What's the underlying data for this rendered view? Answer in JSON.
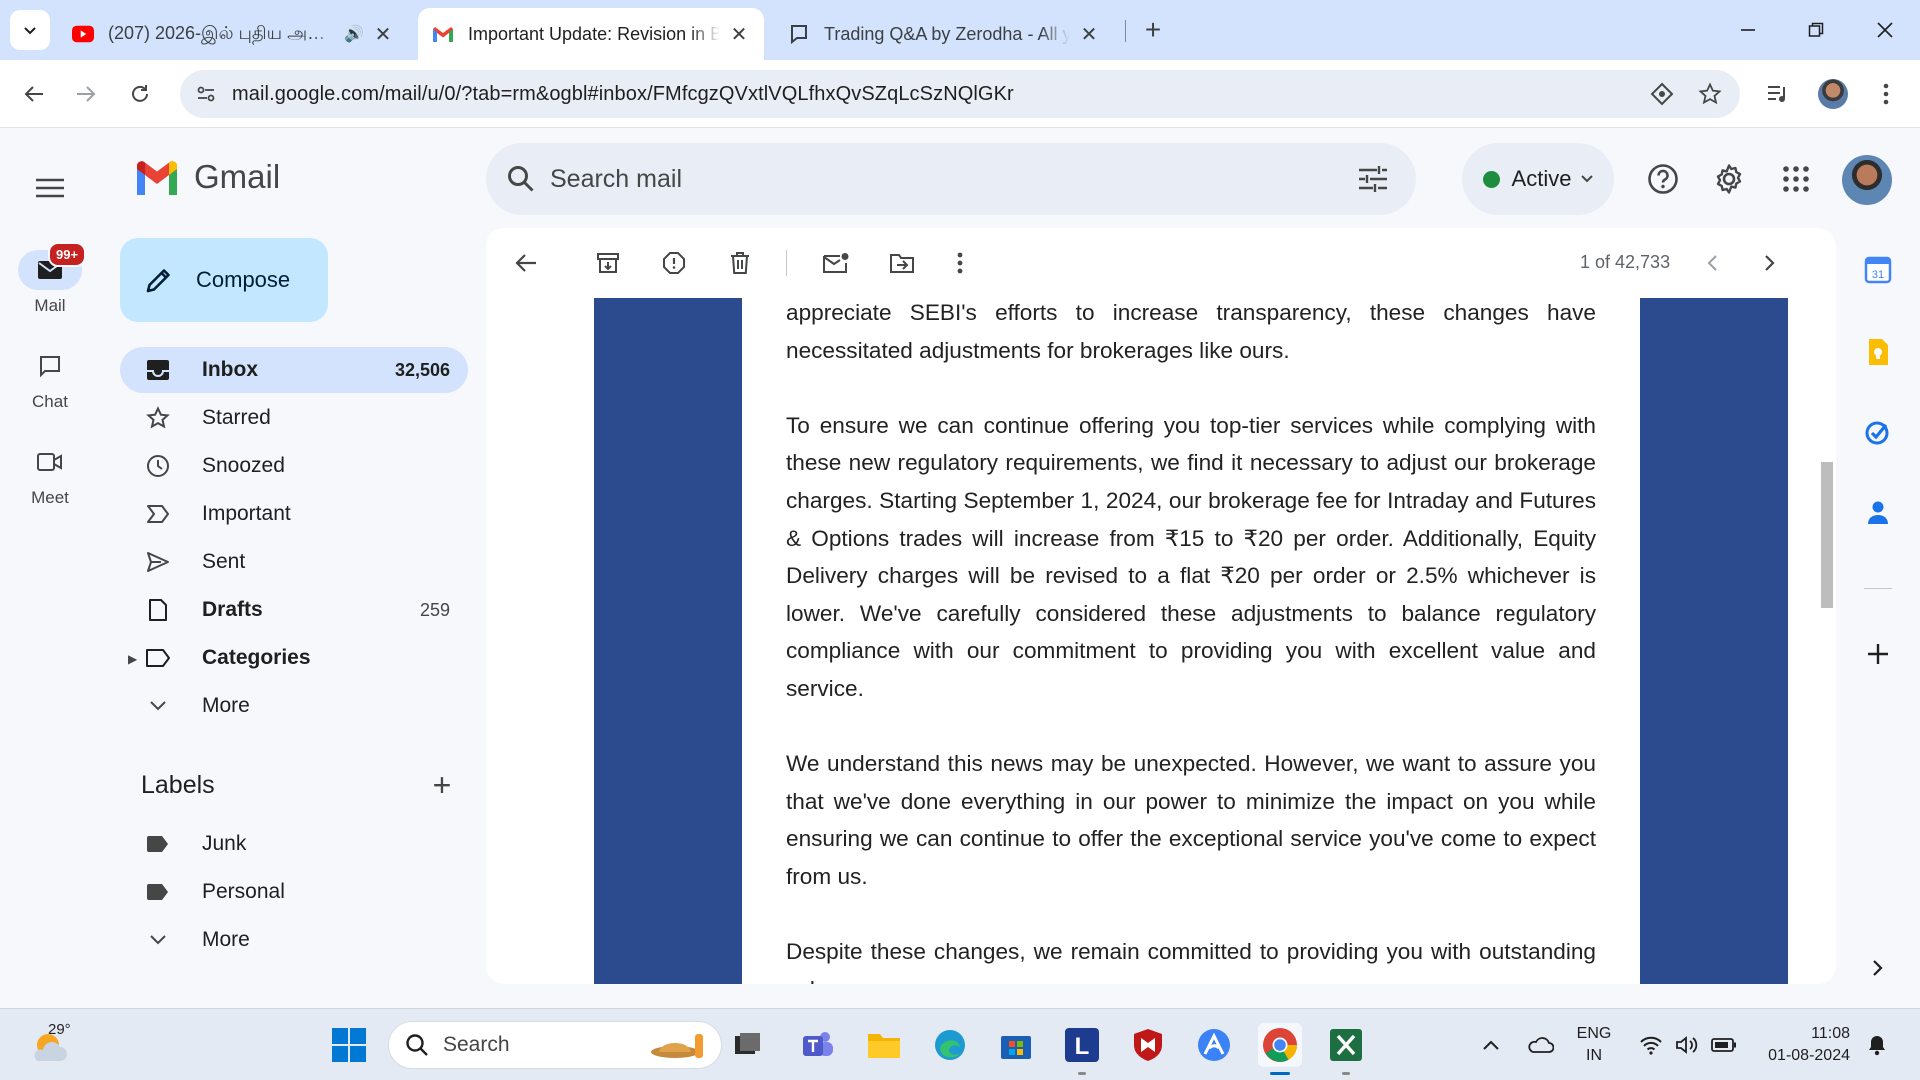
{
  "browser": {
    "tabs": [
      {
        "title": "(207) 2026-இல் புதிய அ…",
        "favicon": "youtube-icon",
        "has_audio": true
      },
      {
        "title": "Important Update: Revision in B",
        "favicon": "gmail-icon",
        "active": true
      },
      {
        "title": "Trading Q&A by Zerodha - All y",
        "favicon": "tradingqa-icon"
      }
    ],
    "url": "mail.google.com/mail/u/0/?tab=rm&ogbl#inbox/FMfcgzQVxtlVQLfhxQvSZqLcSzNQlGKr"
  },
  "gmail": {
    "brand": "Gmail",
    "search_placeholder": "Search mail",
    "status": "Active",
    "rail": {
      "mail_label": "Mail",
      "mail_badge": "99+",
      "chat_label": "Chat",
      "meet_label": "Meet"
    },
    "compose_label": "Compose",
    "nav": [
      {
        "label": "Inbox",
        "count": "32,506",
        "icon": "inbox-icon"
      },
      {
        "label": "Starred",
        "count": "",
        "icon": "star-icon"
      },
      {
        "label": "Snoozed",
        "count": "",
        "icon": "clock-icon"
      },
      {
        "label": "Important",
        "count": "",
        "icon": "important-icon"
      },
      {
        "label": "Sent",
        "count": "",
        "icon": "send-icon"
      },
      {
        "label": "Drafts",
        "count": "259",
        "icon": "draft-icon"
      },
      {
        "label": "Categories",
        "count": "",
        "icon": "label-icon"
      },
      {
        "label": "More",
        "count": "",
        "icon": "chevron-down-icon"
      }
    ],
    "labels_heading": "Labels",
    "labels": [
      {
        "label": "Junk"
      },
      {
        "label": "Personal"
      },
      {
        "label": "More"
      }
    ],
    "pager": "1 of 42,733",
    "email": {
      "paragraphs": [
        "appreciate SEBI's efforts to increase transparency, these changes have necessitated adjustments for brokerages like ours.",
        "To ensure we can continue offering you top-tier services while complying with these new regulatory requirements, we find it necessary to adjust our brokerage charges. Starting September 1, 2024, our brokerage fee for Intraday and Futures & Options trades will increase from ₹15 to ₹20 per order. Additionally, Equity Delivery charges will be revised to a flat ₹20 per order or 2.5% whichever is lower. We've carefully considered these adjustments to balance regulatory compliance with our commitment to providing you with excellent value and service.",
        "We understand this news may be unexpected. However, we want to assure you that we've done everything in our power to minimize the impact on you while ensuring we can continue to offer the exceptional service you've come to expect from us.",
        "Despite these changes, we remain committed to providing you with outstanding value"
      ],
      "accent_color": "#2c4b8f"
    }
  },
  "taskbar": {
    "temperature": "29°",
    "search_label": "Search",
    "lang_line1": "ENG",
    "lang_line2": "IN",
    "time": "11:08",
    "date": "01-08-2024"
  }
}
